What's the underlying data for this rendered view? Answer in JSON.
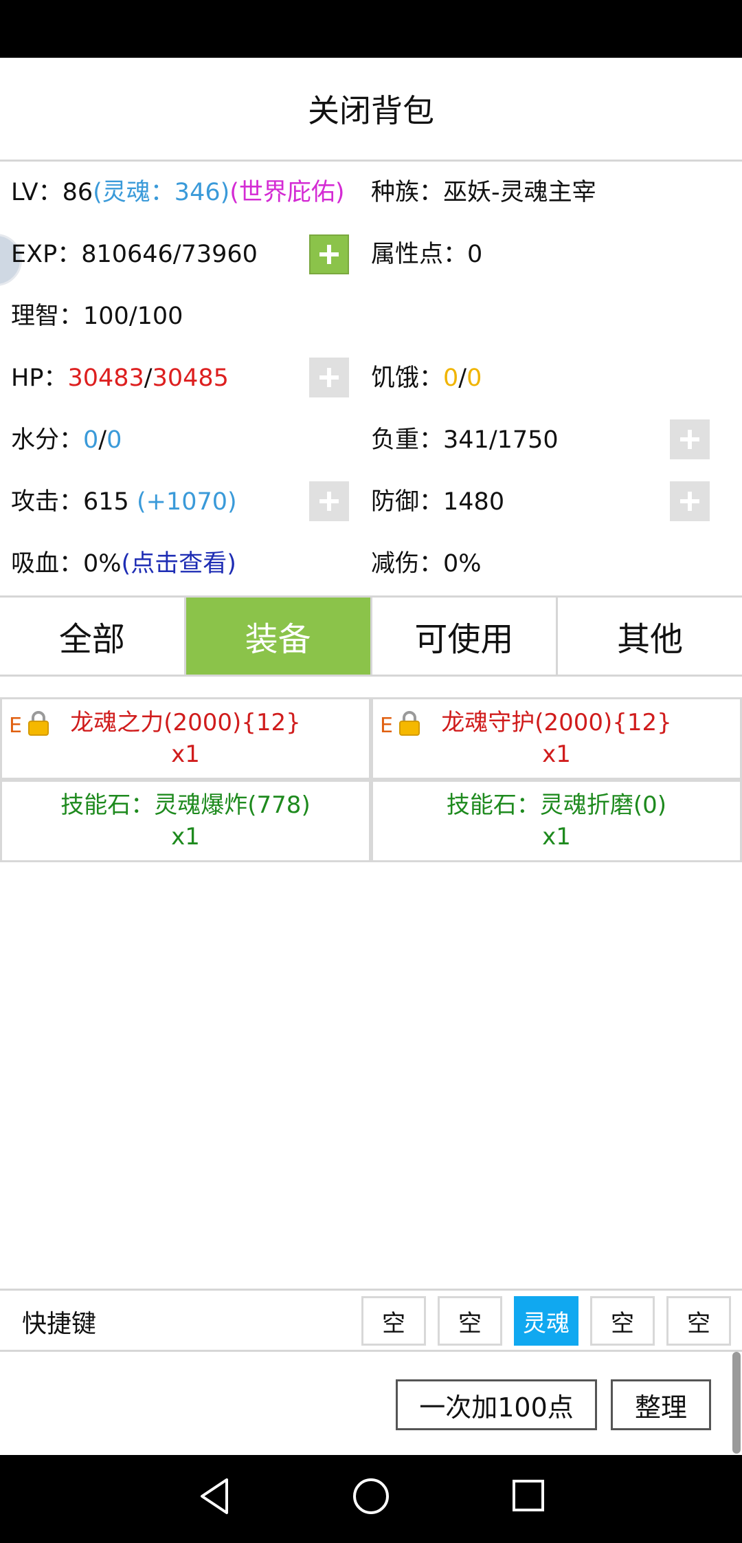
{
  "header": {
    "title": "关闭背包"
  },
  "stats": {
    "lv_label": "LV：",
    "lv_value": "86",
    "lv_soul": "(灵魂：346)",
    "lv_blessing": "(世界庇佑)",
    "race_label": "种族：",
    "race_value": "巫妖-灵魂主宰",
    "exp_label": "EXP：",
    "exp_value": "810646/73960",
    "attr_label": "属性点：",
    "attr_value": "0",
    "sanity_label": "理智：",
    "sanity_value": "100/100",
    "hp_label": "HP：",
    "hp_current": "30483",
    "hp_sep": "/",
    "hp_max": "30485",
    "hunger_label": "饥饿：",
    "hunger_current": "0",
    "hunger_sep": "/",
    "hunger_max": "0",
    "water_label": "水分：",
    "water_current": "0",
    "water_sep": "/",
    "water_max": "0",
    "load_label": "负重：",
    "load_value": "341/1750",
    "attack_label": "攻击：",
    "attack_value": "615 ",
    "attack_bonus": "(+1070)",
    "defense_label": "防御：",
    "defense_value": "1480",
    "lifesteal_label": "吸血：",
    "lifesteal_value": "0%",
    "lifesteal_link": "(点击查看)",
    "reduction_label": "减伤：",
    "reduction_value": "0%"
  },
  "tabs": [
    {
      "label": "全部"
    },
    {
      "label": "装备"
    },
    {
      "label": "可使用"
    },
    {
      "label": "其他"
    }
  ],
  "active_tab": "装备",
  "items": [
    {
      "badge": "E",
      "name": "龙魂之力(2000){12}",
      "qty": "x1",
      "color": "#d01c1c",
      "locked": true
    },
    {
      "badge": "E",
      "name": "龙魂守护(2000){12}",
      "qty": "x1",
      "color": "#d01c1c",
      "locked": true
    },
    {
      "name": "技能石：灵魂爆炸(778)",
      "qty": "x1",
      "color": "#1e8a1e",
      "locked": false
    },
    {
      "name": "技能石：灵魂折磨(0)",
      "qty": "x1",
      "color": "#1e8a1e",
      "locked": false
    }
  ],
  "quickbar": {
    "label": "快捷键",
    "slots": [
      "空",
      "空",
      "灵魂",
      "空",
      "空"
    ],
    "active_slot": "灵魂"
  },
  "actions": {
    "add100_label": "一次加100点",
    "sort_label": "整理"
  },
  "colors": {
    "accent_green": "#8bc34a",
    "slot_active_blue": "#10a8f0",
    "equip_red": "#d01c1c",
    "skill_green": "#1e8a1e"
  }
}
